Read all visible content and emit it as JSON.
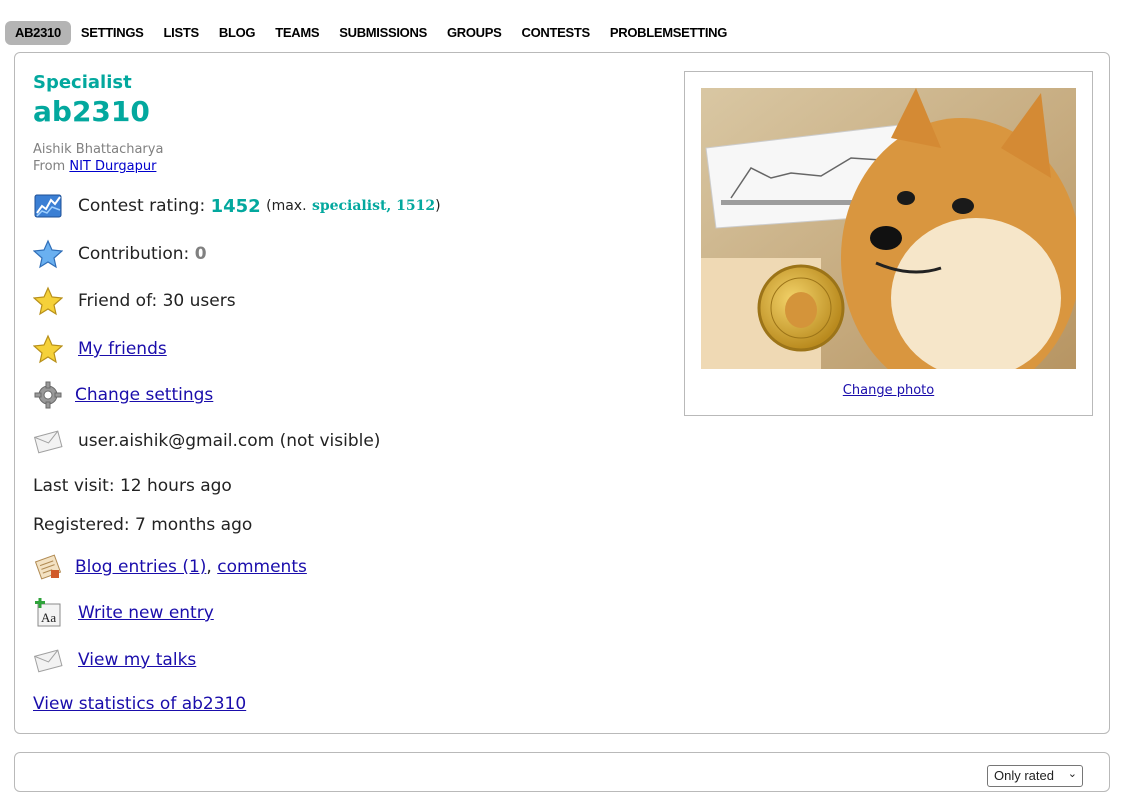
{
  "nav": {
    "tabs": [
      "AB2310",
      "SETTINGS",
      "LISTS",
      "BLOG",
      "TEAMS",
      "SUBMISSIONS",
      "GROUPS",
      "CONTESTS",
      "PROBLEMSETTING"
    ],
    "active_index": 0
  },
  "profile": {
    "rank": "Specialist",
    "handle": "ab2310",
    "real_name": "Aishik Bhattacharya",
    "from_label": "From",
    "organization": "NIT Durgapur",
    "contest_rating_label": "Contest rating:",
    "contest_rating": "1452",
    "max_prefix": "(max.",
    "max_rank_rating": "specialist, 1512",
    "max_suffix": ")",
    "contribution_label": "Contribution:",
    "contribution": "0",
    "friend_of": "Friend of: 30 users",
    "my_friends": "My friends",
    "change_settings": "Change settings",
    "email": "user.aishik@gmail.com (not visible)",
    "last_visit": "Last visit: 12 hours ago",
    "registered": "Registered: 7 months ago",
    "blog_entries": "Blog entries (1)",
    "comma": ",",
    "comments": "comments",
    "write_new_entry": "Write new entry",
    "view_talks": "View my talks",
    "view_statistics": "View statistics of ab2310",
    "change_photo": "Change photo"
  },
  "filter": {
    "selected": "Only rated"
  },
  "colors": {
    "specialist": "#03a89e",
    "link": "#1a0dab",
    "tab_active_bg": "#b4b4b4"
  },
  "icons": [
    "chart-icon",
    "blue-star-icon",
    "gold-star-icon",
    "gear-icon",
    "envelope-icon",
    "blog-icon",
    "new-entry-icon"
  ]
}
